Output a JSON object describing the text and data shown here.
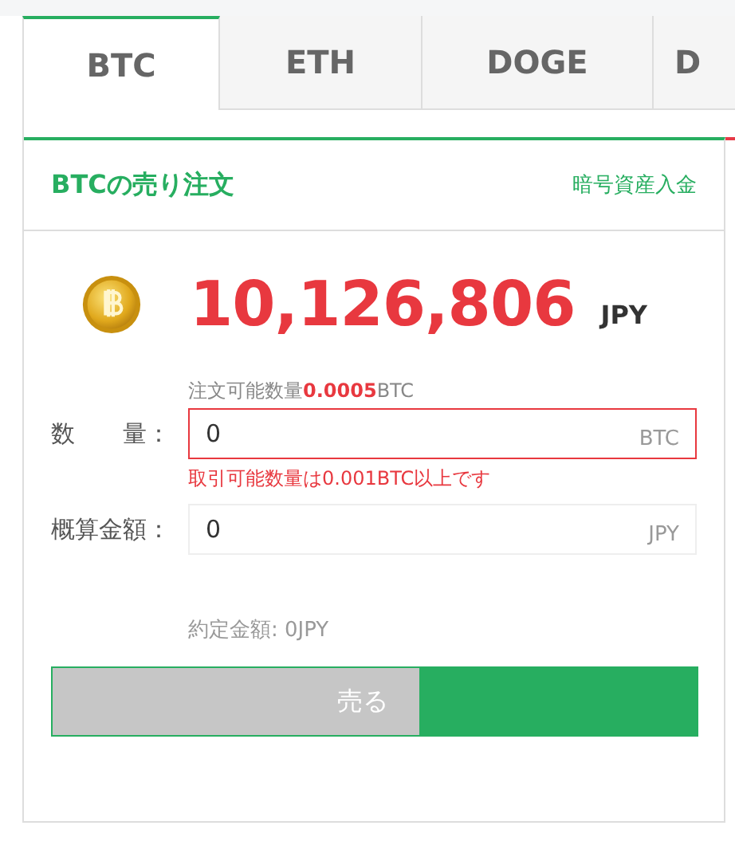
{
  "tabs": [
    {
      "label": "BTC",
      "selected": true
    },
    {
      "label": "ETH",
      "selected": false
    },
    {
      "label": "DOGE",
      "selected": false
    },
    {
      "label": "D",
      "selected": false
    }
  ],
  "panel": {
    "title": "BTCの売り注文",
    "deposit_link": "暗号資産入金",
    "price": "10,126,806",
    "price_unit": "JPY",
    "available": "注文可能数量**0.0005**BTC",
    "fields": [
      {
        "label": "数　　量：",
        "value": "0",
        "unit": "BTC",
        "invalid": true,
        "error": "取引可能数量は0.001BTC以上です"
      },
      {
        "label": "概算金額：",
        "value": "0",
        "unit": "JPY",
        "invalid": false
      }
    ],
    "contract_amount": "約定金額: 0JPY",
    "sell_button": {
      "label": "売る",
      "level": 0.57
    }
  }
}
